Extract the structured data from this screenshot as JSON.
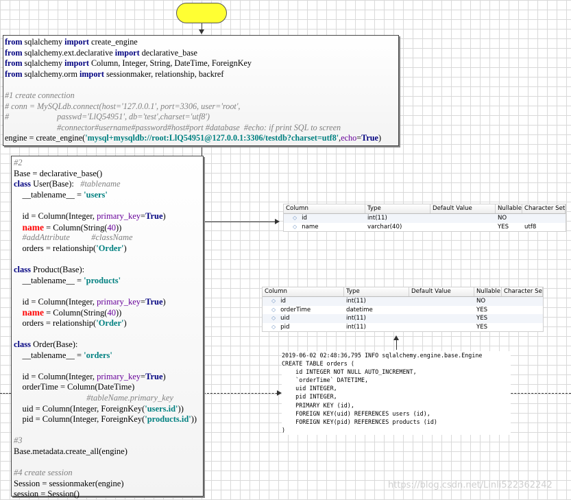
{
  "code1": [
    [
      [
        "from",
        "kw"
      ],
      [
        " sqlalchemy ",
        ""
      ],
      [
        "import",
        "kw"
      ],
      [
        " create_engine",
        ""
      ]
    ],
    [
      [
        "from",
        "kw"
      ],
      [
        " sqlalchemy.ext.declarative ",
        ""
      ],
      [
        "import",
        "kw"
      ],
      [
        " declarative_base",
        ""
      ]
    ],
    [
      [
        "from",
        "kw"
      ],
      [
        " sqlalchemy ",
        ""
      ],
      [
        "import",
        "kw"
      ],
      [
        " Column, Integer, String, DateTime, ForeignKey",
        ""
      ]
    ],
    [
      [
        "from",
        "kw"
      ],
      [
        " sqlalchemy.orm ",
        ""
      ],
      [
        "import",
        "kw"
      ],
      [
        " sessionmaker, relationship, backref",
        ""
      ]
    ],
    [],
    [
      [
        "#1 create connection",
        "cm"
      ]
    ],
    [
      [
        "# conn = MySQLdb.connect(host='127.0.0.1', port=3306, user='root',",
        "cm"
      ]
    ],
    [
      [
        "#                       passwd='LlQ54951', db='test',charset='utf8')",
        "cm"
      ]
    ],
    [
      [
        "                         #connector#username#password#host#port #database  #echo: if print SQL to screen",
        "cm"
      ]
    ],
    [
      [
        "engine = create_engine(",
        ""
      ],
      [
        "'mysql+mysqldb://root:LlQ54951@127.0.0.1:3306/testdb?charset=utf8'",
        "st"
      ],
      [
        ",",
        ""
      ],
      [
        "echo",
        "pa"
      ],
      [
        "=",
        ""
      ],
      [
        "True",
        "tr"
      ],
      [
        ")",
        ""
      ]
    ]
  ],
  "code2": [
    [
      [
        "#2",
        "cm"
      ]
    ],
    [
      [
        "Base = declarative_base()",
        ""
      ]
    ],
    [
      [
        "class",
        "kw"
      ],
      [
        " User(Base):   ",
        ""
      ],
      [
        "#tablename",
        "cm"
      ]
    ],
    [
      [
        "    __tablename__ = ",
        ""
      ],
      [
        "'users'",
        "st"
      ]
    ],
    [],
    [
      [
        "    id = Column(Integer, ",
        ""
      ],
      [
        "primary_key",
        "pa"
      ],
      [
        "=",
        ""
      ],
      [
        "True",
        "tr"
      ],
      [
        ")",
        ""
      ]
    ],
    [
      [
        "    ",
        ""
      ],
      [
        "name",
        "nm"
      ],
      [
        " = Column(String(",
        ""
      ],
      [
        "40",
        "pa"
      ],
      [
        "))",
        ""
      ]
    ],
    [
      [
        "    #addAttribute          #className",
        "cm"
      ]
    ],
    [
      [
        "    orders = relationship(",
        ""
      ],
      [
        "'Order'",
        "st"
      ],
      [
        ")",
        ""
      ]
    ],
    [],
    [
      [
        "class",
        "kw"
      ],
      [
        " Product(Base):",
        ""
      ]
    ],
    [
      [
        "    __tablename__ = ",
        ""
      ],
      [
        "'products'",
        "st"
      ]
    ],
    [],
    [
      [
        "    id = Column(Integer, ",
        ""
      ],
      [
        "primary_key",
        "pa"
      ],
      [
        "=",
        ""
      ],
      [
        "True",
        "tr"
      ],
      [
        ")",
        ""
      ]
    ],
    [
      [
        "    ",
        ""
      ],
      [
        "name",
        "nm"
      ],
      [
        " = Column(String(",
        ""
      ],
      [
        "40",
        "pa"
      ],
      [
        "))",
        ""
      ]
    ],
    [
      [
        "    orders = relationship(",
        ""
      ],
      [
        "'Order'",
        "st"
      ],
      [
        ")",
        ""
      ]
    ],
    [],
    [
      [
        "class",
        "kw"
      ],
      [
        " Order(Base):",
        ""
      ]
    ],
    [
      [
        "    __tablename__ = ",
        ""
      ],
      [
        "'orders'",
        "st"
      ]
    ],
    [],
    [
      [
        "    id = Column(Integer, ",
        ""
      ],
      [
        "primary_key",
        "pa"
      ],
      [
        "=",
        ""
      ],
      [
        "True",
        "tr"
      ],
      [
        ")",
        ""
      ]
    ],
    [
      [
        "    orderTime = Column(DateTime)",
        ""
      ]
    ],
    [
      [
        "                                  #tableName.primary_key",
        "cm"
      ]
    ],
    [
      [
        "    uid = Column(Integer, ForeignKey(",
        ""
      ],
      [
        "'users.id'",
        "st"
      ],
      [
        "))",
        ""
      ]
    ],
    [
      [
        "    pid = Column(Integer, ForeignKey(",
        ""
      ],
      [
        "'products.id'",
        "st"
      ],
      [
        "))",
        ""
      ]
    ],
    [],
    [
      [
        "#3",
        "cm"
      ]
    ],
    [
      [
        "Base.metadata.create_all(engine)",
        ""
      ]
    ],
    [],
    [
      [
        "#4 create session",
        "cm"
      ]
    ],
    [
      [
        "Session = sessionmaker(engine)",
        ""
      ]
    ],
    [
      [
        "session = Session()",
        ""
      ]
    ]
  ],
  "users_table": {
    "headers": [
      "Column",
      "Type",
      "Default Value",
      "Nullable",
      "Character Set"
    ],
    "rows": [
      [
        "id",
        "int(11)",
        "",
        "NO",
        ""
      ],
      [
        "name",
        "varchar(40)",
        "",
        "YES",
        "utf8"
      ]
    ]
  },
  "orders_table": {
    "headers": [
      "Column",
      "Type",
      "Default Value",
      "Nullable",
      "Character Set"
    ],
    "rows": [
      [
        "id",
        "int(11)",
        "",
        "NO",
        ""
      ],
      [
        "orderTime",
        "datetime",
        "",
        "YES",
        ""
      ],
      [
        "uid",
        "int(11)",
        "",
        "YES",
        ""
      ],
      [
        "pid",
        "int(11)",
        "",
        "YES",
        ""
      ]
    ]
  },
  "sql_log": [
    "2019-06-02 02:48:36,795 INFO sqlalchemy.engine.base.Engine",
    "CREATE TABLE orders (",
    "    id INTEGER NOT NULL AUTO_INCREMENT,",
    "    `orderTime` DATETIME,",
    "    uid INTEGER,",
    "    pid INTEGER,",
    "    PRIMARY KEY (id),",
    "    FOREIGN KEY(uid) REFERENCES users (id),",
    "    FOREIGN KEY(pid) REFERENCES products (id)",
    ")"
  ],
  "watermark": "https://blog.csdn.net/Linli522362242"
}
